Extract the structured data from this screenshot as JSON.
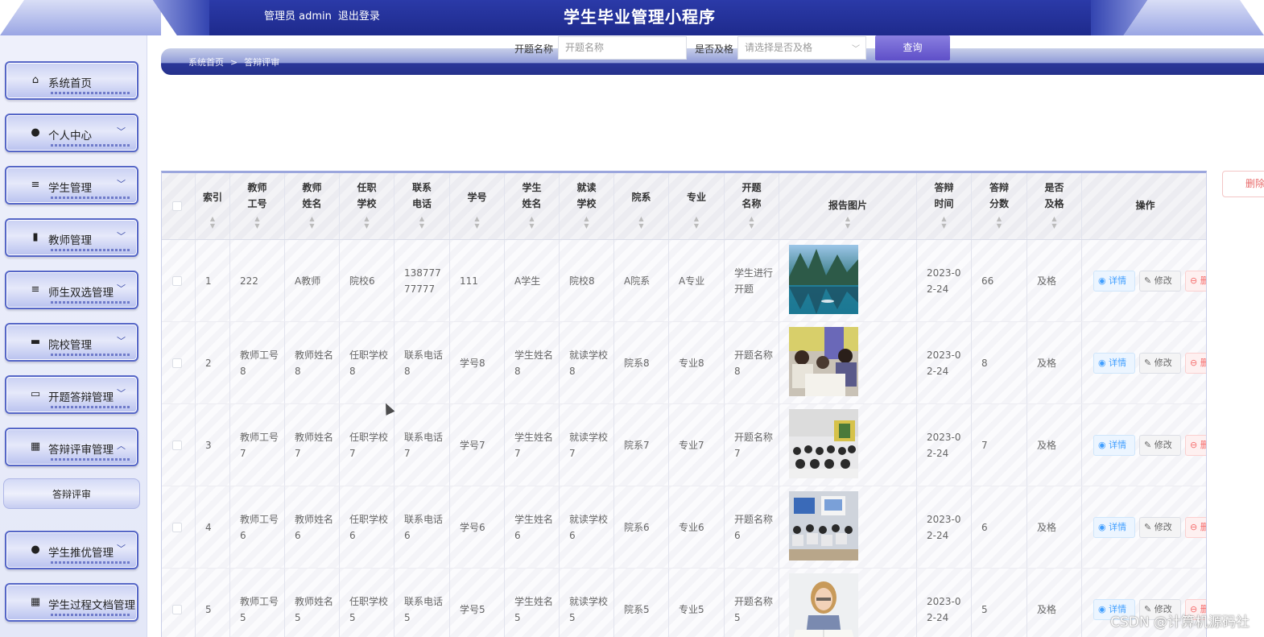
{
  "header": {
    "role": "管理员 admin",
    "logout": "退出登录",
    "title": "学生毕业管理小程序"
  },
  "sidebar": {
    "items": [
      {
        "label": "系统首页",
        "icon": "home-icon",
        "glyph": "⌂",
        "chevron": ""
      },
      {
        "label": "个人中心",
        "icon": "user-icon",
        "glyph": "●",
        "chevron": "﹀"
      },
      {
        "label": "学生管理",
        "icon": "list-icon",
        "glyph": "≡",
        "chevron": "﹀"
      },
      {
        "label": "教师管理",
        "icon": "book-icon",
        "glyph": "▮",
        "chevron": "﹀"
      },
      {
        "label": "师生双选管理",
        "icon": "list-icon",
        "glyph": "≡",
        "chevron": "﹀"
      },
      {
        "label": "院校管理",
        "icon": "chat-icon",
        "glyph": "▬",
        "chevron": "﹀"
      },
      {
        "label": "开题答辩管理",
        "icon": "monitor-icon",
        "glyph": "▭",
        "chevron": "﹀"
      },
      {
        "label": "答辩评审管理",
        "icon": "grid-icon",
        "glyph": "▦",
        "chevron": "︿"
      },
      {
        "label": "学生推优管理",
        "icon": "user-icon",
        "glyph": "●",
        "chevron": "﹀"
      },
      {
        "label": "学生过程文档管理",
        "icon": "grid-icon",
        "glyph": "▦",
        "chevron": ""
      }
    ],
    "submenu": "答辩评审"
  },
  "breadcrumb": {
    "home": "系统首页",
    "sep": ">",
    "current": "答辩评审"
  },
  "search": {
    "topic_label": "开题名称",
    "topic_placeholder": "开题名称",
    "pass_label": "是否及格",
    "pass_placeholder": "请选择是否及格",
    "query_button": "查询"
  },
  "delete_button": "删除",
  "table": {
    "headers": [
      "索引",
      "教师\n工号",
      "教师\n姓名",
      "任职\n学校",
      "联系\n电话",
      "学号",
      "学生\n姓名",
      "就读\n学校",
      "院系",
      "专业",
      "开题\n名称",
      "报告图片",
      "答辩\n时间",
      "答辩\n分数",
      "是否\n及格",
      "操作"
    ],
    "actions": {
      "detail": "◉ 详情",
      "edit": "✎ 修改",
      "delete": "⊖ 删除"
    },
    "rows": [
      {
        "index": "1",
        "teacher_no": "222",
        "teacher_name": "A教师",
        "school": "院校6",
        "phone": "13877777777",
        "student_no": "111",
        "student_name": "A学生",
        "study_school": "院校8",
        "dept": "A院系",
        "major": "A专业",
        "topic": "学生进行开题",
        "image": "lake-photo",
        "time": "2023-02-24",
        "score": "66",
        "pass": "及格"
      },
      {
        "index": "2",
        "teacher_no": "教师工号8",
        "teacher_name": "教师姓名8",
        "school": "任职学校8",
        "phone": "联系电话8",
        "student_no": "学号8",
        "student_name": "学生姓名8",
        "study_school": "就读学校8",
        "dept": "院系8",
        "major": "专业8",
        "topic": "开题名称8",
        "image": "students-table-photo",
        "time": "2023-02-24",
        "score": "8",
        "pass": "及格"
      },
      {
        "index": "3",
        "teacher_no": "教师工号7",
        "teacher_name": "教师姓名7",
        "school": "任职学校7",
        "phone": "联系电话7",
        "student_no": "学号7",
        "student_name": "学生姓名7",
        "study_school": "就读学校7",
        "dept": "院系7",
        "major": "专业7",
        "topic": "开题名称7",
        "image": "classroom-photo",
        "time": "2023-02-24",
        "score": "7",
        "pass": "及格"
      },
      {
        "index": "4",
        "teacher_no": "教师工号6",
        "teacher_name": "教师姓名6",
        "school": "任职学校6",
        "phone": "联系电话6",
        "student_no": "学号6",
        "student_name": "学生姓名6",
        "study_school": "就读学校6",
        "dept": "院系6",
        "major": "专业6",
        "topic": "开题名称6",
        "image": "lecture-photo",
        "time": "2023-02-24",
        "score": "6",
        "pass": "及格"
      },
      {
        "index": "5",
        "teacher_no": "教师工号5",
        "teacher_name": "教师姓名5",
        "school": "任职学校5",
        "phone": "联系电话5",
        "student_no": "学号5",
        "student_name": "学生姓名5",
        "study_school": "就读学校5",
        "dept": "院系5",
        "major": "专业5",
        "topic": "开题名称5",
        "image": "reading-student-photo",
        "time": "2023-02-24",
        "score": "5",
        "pass": "及格"
      }
    ]
  },
  "watermark": "CSDN @计算机源码社"
}
